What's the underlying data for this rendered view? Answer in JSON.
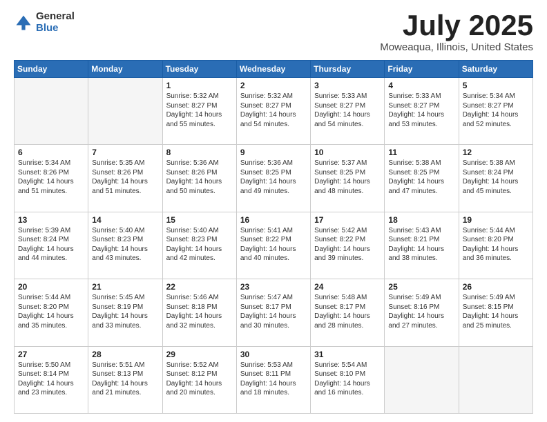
{
  "header": {
    "logo_general": "General",
    "logo_blue": "Blue",
    "title": "July 2025",
    "location": "Moweaqua, Illinois, United States"
  },
  "days_of_week": [
    "Sunday",
    "Monday",
    "Tuesday",
    "Wednesday",
    "Thursday",
    "Friday",
    "Saturday"
  ],
  "weeks": [
    [
      {
        "day": "",
        "empty": true
      },
      {
        "day": "",
        "empty": true
      },
      {
        "day": "1",
        "sunrise": "Sunrise: 5:32 AM",
        "sunset": "Sunset: 8:27 PM",
        "daylight": "Daylight: 14 hours and 55 minutes."
      },
      {
        "day": "2",
        "sunrise": "Sunrise: 5:32 AM",
        "sunset": "Sunset: 8:27 PM",
        "daylight": "Daylight: 14 hours and 54 minutes."
      },
      {
        "day": "3",
        "sunrise": "Sunrise: 5:33 AM",
        "sunset": "Sunset: 8:27 PM",
        "daylight": "Daylight: 14 hours and 54 minutes."
      },
      {
        "day": "4",
        "sunrise": "Sunrise: 5:33 AM",
        "sunset": "Sunset: 8:27 PM",
        "daylight": "Daylight: 14 hours and 53 minutes."
      },
      {
        "day": "5",
        "sunrise": "Sunrise: 5:34 AM",
        "sunset": "Sunset: 8:27 PM",
        "daylight": "Daylight: 14 hours and 52 minutes."
      }
    ],
    [
      {
        "day": "6",
        "sunrise": "Sunrise: 5:34 AM",
        "sunset": "Sunset: 8:26 PM",
        "daylight": "Daylight: 14 hours and 51 minutes."
      },
      {
        "day": "7",
        "sunrise": "Sunrise: 5:35 AM",
        "sunset": "Sunset: 8:26 PM",
        "daylight": "Daylight: 14 hours and 51 minutes."
      },
      {
        "day": "8",
        "sunrise": "Sunrise: 5:36 AM",
        "sunset": "Sunset: 8:26 PM",
        "daylight": "Daylight: 14 hours and 50 minutes."
      },
      {
        "day": "9",
        "sunrise": "Sunrise: 5:36 AM",
        "sunset": "Sunset: 8:25 PM",
        "daylight": "Daylight: 14 hours and 49 minutes."
      },
      {
        "day": "10",
        "sunrise": "Sunrise: 5:37 AM",
        "sunset": "Sunset: 8:25 PM",
        "daylight": "Daylight: 14 hours and 48 minutes."
      },
      {
        "day": "11",
        "sunrise": "Sunrise: 5:38 AM",
        "sunset": "Sunset: 8:25 PM",
        "daylight": "Daylight: 14 hours and 47 minutes."
      },
      {
        "day": "12",
        "sunrise": "Sunrise: 5:38 AM",
        "sunset": "Sunset: 8:24 PM",
        "daylight": "Daylight: 14 hours and 45 minutes."
      }
    ],
    [
      {
        "day": "13",
        "sunrise": "Sunrise: 5:39 AM",
        "sunset": "Sunset: 8:24 PM",
        "daylight": "Daylight: 14 hours and 44 minutes."
      },
      {
        "day": "14",
        "sunrise": "Sunrise: 5:40 AM",
        "sunset": "Sunset: 8:23 PM",
        "daylight": "Daylight: 14 hours and 43 minutes."
      },
      {
        "day": "15",
        "sunrise": "Sunrise: 5:40 AM",
        "sunset": "Sunset: 8:23 PM",
        "daylight": "Daylight: 14 hours and 42 minutes."
      },
      {
        "day": "16",
        "sunrise": "Sunrise: 5:41 AM",
        "sunset": "Sunset: 8:22 PM",
        "daylight": "Daylight: 14 hours and 40 minutes."
      },
      {
        "day": "17",
        "sunrise": "Sunrise: 5:42 AM",
        "sunset": "Sunset: 8:22 PM",
        "daylight": "Daylight: 14 hours and 39 minutes."
      },
      {
        "day": "18",
        "sunrise": "Sunrise: 5:43 AM",
        "sunset": "Sunset: 8:21 PM",
        "daylight": "Daylight: 14 hours and 38 minutes."
      },
      {
        "day": "19",
        "sunrise": "Sunrise: 5:44 AM",
        "sunset": "Sunset: 8:20 PM",
        "daylight": "Daylight: 14 hours and 36 minutes."
      }
    ],
    [
      {
        "day": "20",
        "sunrise": "Sunrise: 5:44 AM",
        "sunset": "Sunset: 8:20 PM",
        "daylight": "Daylight: 14 hours and 35 minutes."
      },
      {
        "day": "21",
        "sunrise": "Sunrise: 5:45 AM",
        "sunset": "Sunset: 8:19 PM",
        "daylight": "Daylight: 14 hours and 33 minutes."
      },
      {
        "day": "22",
        "sunrise": "Sunrise: 5:46 AM",
        "sunset": "Sunset: 8:18 PM",
        "daylight": "Daylight: 14 hours and 32 minutes."
      },
      {
        "day": "23",
        "sunrise": "Sunrise: 5:47 AM",
        "sunset": "Sunset: 8:17 PM",
        "daylight": "Daylight: 14 hours and 30 minutes."
      },
      {
        "day": "24",
        "sunrise": "Sunrise: 5:48 AM",
        "sunset": "Sunset: 8:17 PM",
        "daylight": "Daylight: 14 hours and 28 minutes."
      },
      {
        "day": "25",
        "sunrise": "Sunrise: 5:49 AM",
        "sunset": "Sunset: 8:16 PM",
        "daylight": "Daylight: 14 hours and 27 minutes."
      },
      {
        "day": "26",
        "sunrise": "Sunrise: 5:49 AM",
        "sunset": "Sunset: 8:15 PM",
        "daylight": "Daylight: 14 hours and 25 minutes."
      }
    ],
    [
      {
        "day": "27",
        "sunrise": "Sunrise: 5:50 AM",
        "sunset": "Sunset: 8:14 PM",
        "daylight": "Daylight: 14 hours and 23 minutes."
      },
      {
        "day": "28",
        "sunrise": "Sunrise: 5:51 AM",
        "sunset": "Sunset: 8:13 PM",
        "daylight": "Daylight: 14 hours and 21 minutes."
      },
      {
        "day": "29",
        "sunrise": "Sunrise: 5:52 AM",
        "sunset": "Sunset: 8:12 PM",
        "daylight": "Daylight: 14 hours and 20 minutes."
      },
      {
        "day": "30",
        "sunrise": "Sunrise: 5:53 AM",
        "sunset": "Sunset: 8:11 PM",
        "daylight": "Daylight: 14 hours and 18 minutes."
      },
      {
        "day": "31",
        "sunrise": "Sunrise: 5:54 AM",
        "sunset": "Sunset: 8:10 PM",
        "daylight": "Daylight: 14 hours and 16 minutes."
      },
      {
        "day": "",
        "empty": true
      },
      {
        "day": "",
        "empty": true
      }
    ]
  ]
}
